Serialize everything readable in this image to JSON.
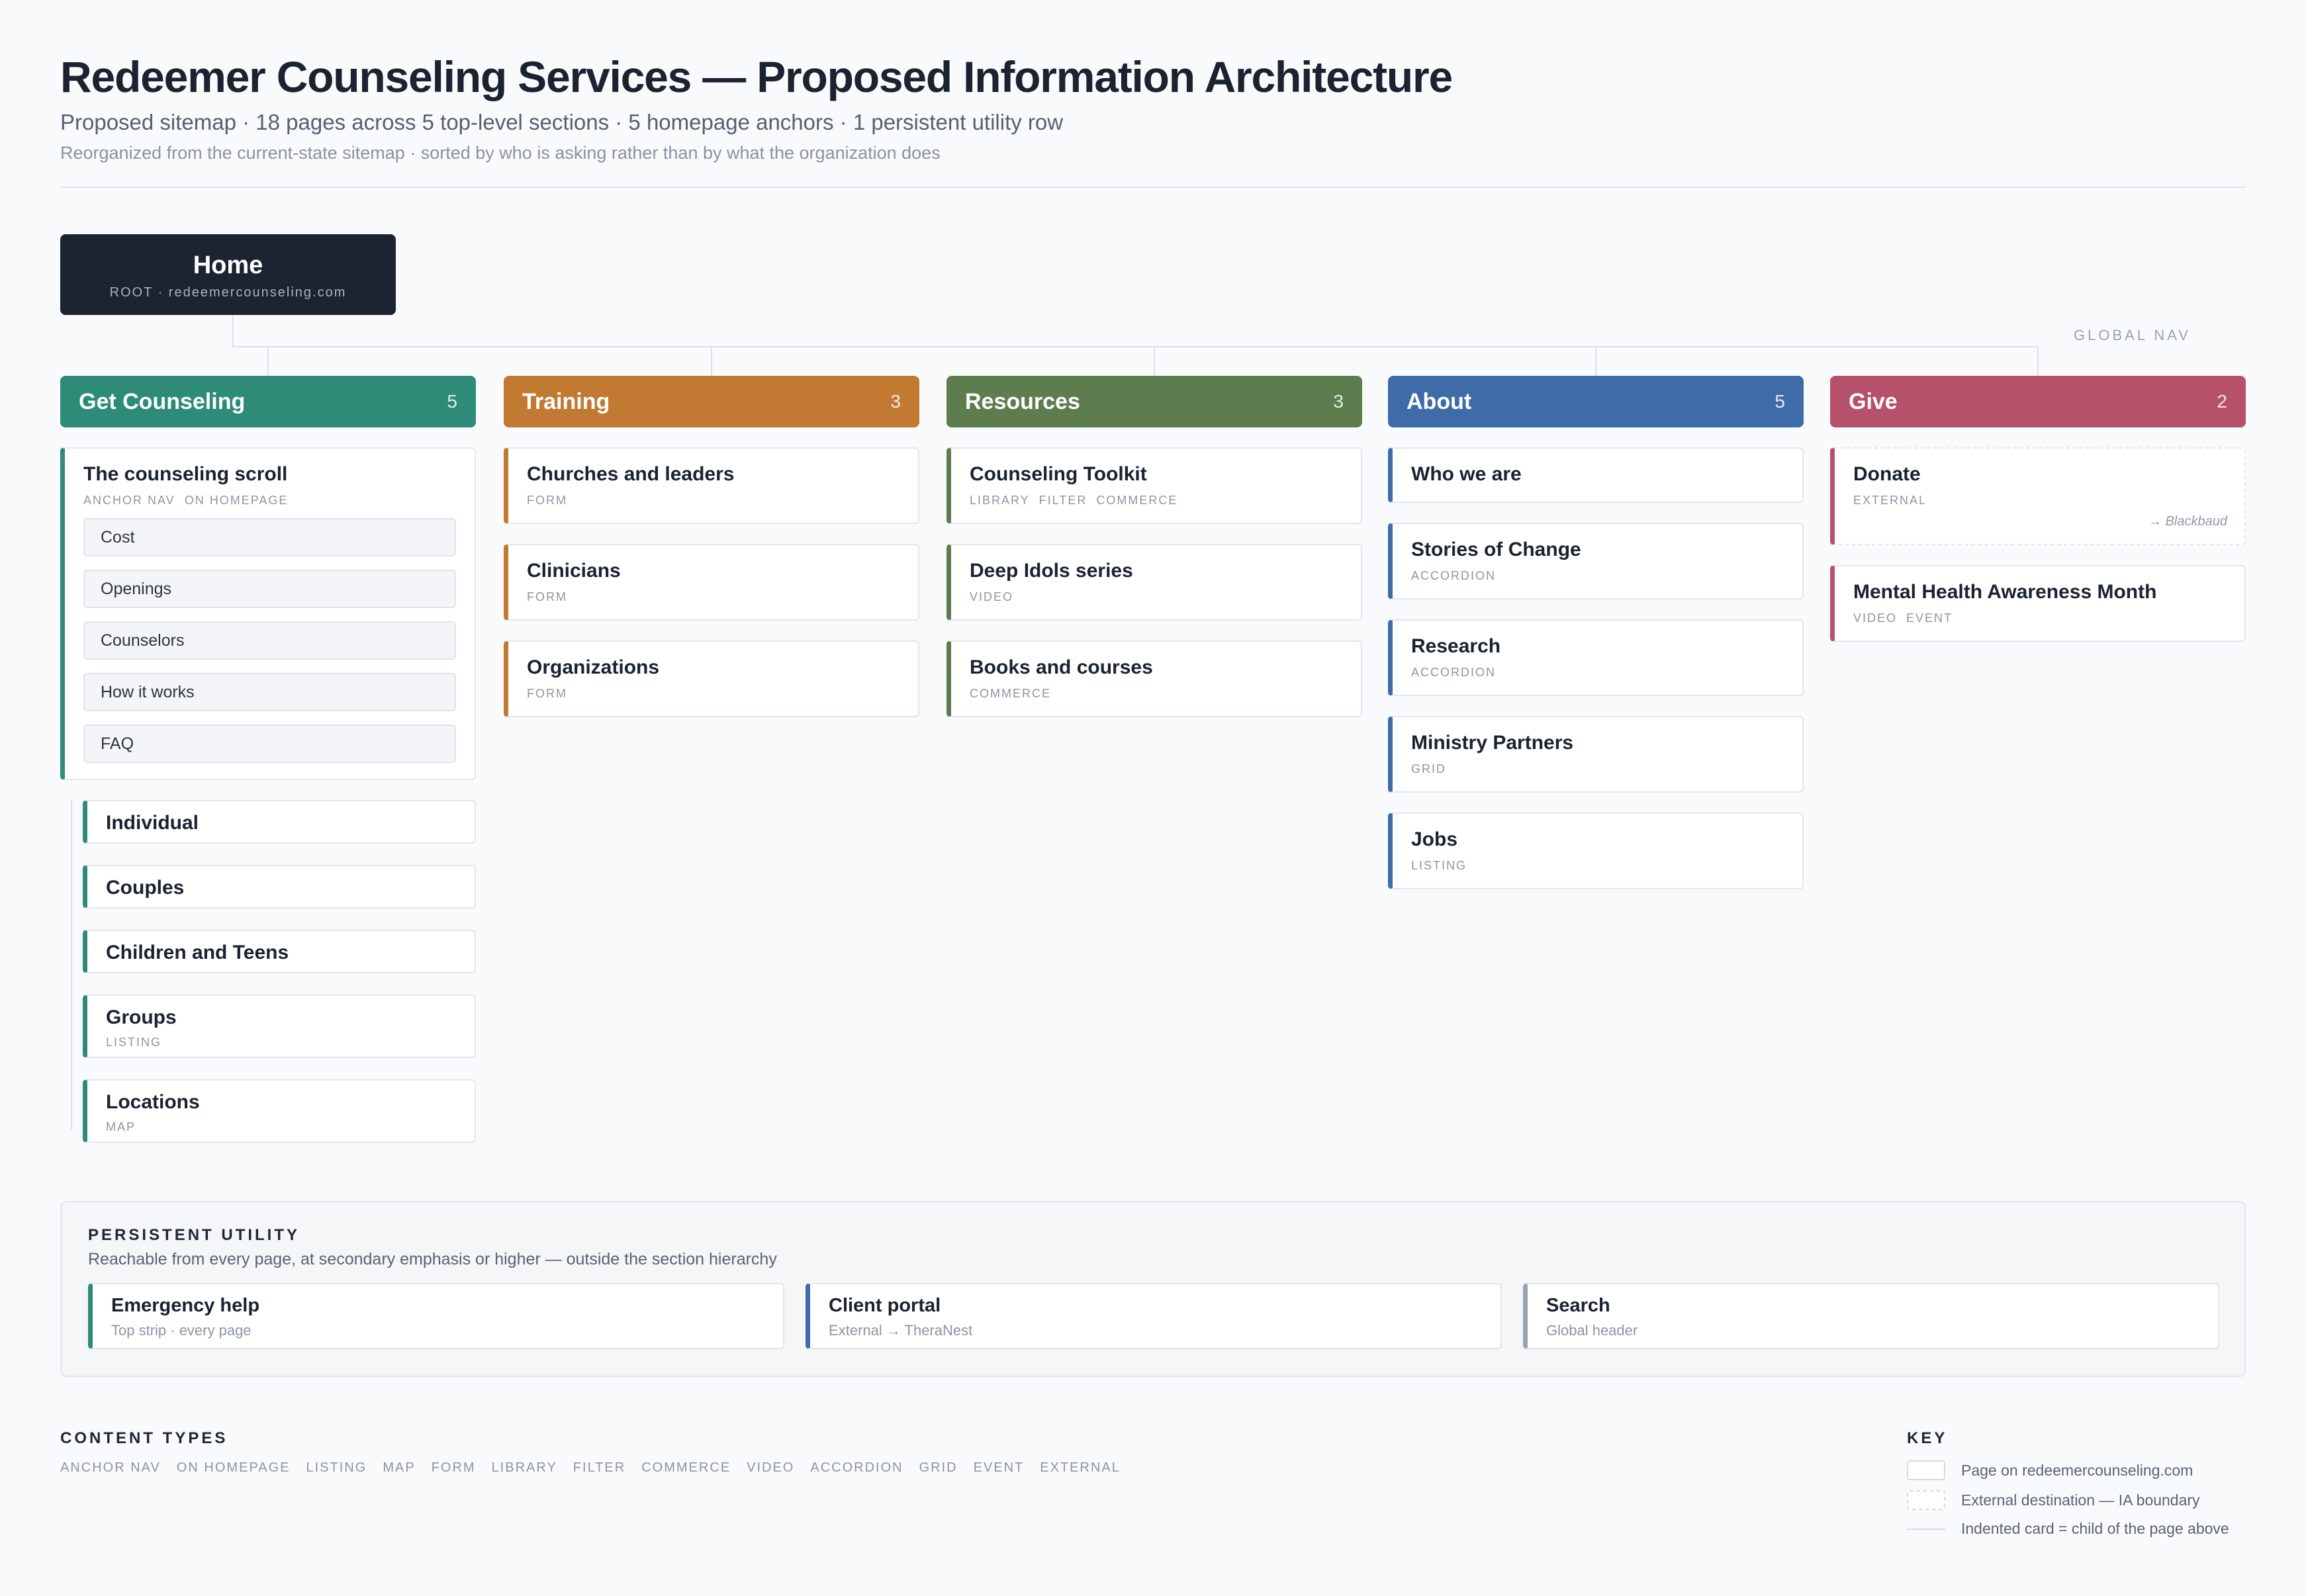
{
  "header": {
    "title": "Redeemer Counseling Services — Proposed Information Architecture",
    "subtitle": "Proposed sitemap · 18 pages across 5 top-level sections · 5 homepage anchors · 1 persistent utility row",
    "note": "Reorganized from the current-state sitemap · sorted by who is asking rather than by what the organization does"
  },
  "home": {
    "label": "Home",
    "sub": "ROOT · redeemercounseling.com"
  },
  "global_nav_label": "GLOBAL NAV",
  "sections": [
    {
      "name": "Get Counseling",
      "count": "5",
      "color": "#2e8b77",
      "scroll": {
        "name": "The counseling scroll",
        "tags": [
          "ANCHOR NAV",
          "ON HOMEPAGE"
        ],
        "anchors": [
          "Cost",
          "Openings",
          "Counselors",
          "How it works",
          "FAQ"
        ]
      },
      "children": [
        {
          "name": "Individual",
          "tags": []
        },
        {
          "name": "Couples",
          "tags": []
        },
        {
          "name": "Children and Teens",
          "tags": []
        },
        {
          "name": "Groups",
          "tags": [
            "LISTING"
          ]
        },
        {
          "name": "Locations",
          "tags": [
            "MAP"
          ]
        }
      ]
    },
    {
      "name": "Training",
      "count": "3",
      "color": "#c27a32",
      "pages": [
        {
          "name": "Churches and leaders",
          "tags": [
            "FORM"
          ]
        },
        {
          "name": "Clinicians",
          "tags": [
            "FORM"
          ]
        },
        {
          "name": "Organizations",
          "tags": [
            "FORM"
          ]
        }
      ]
    },
    {
      "name": "Resources",
      "count": "3",
      "color": "#5e7d4e",
      "pages": [
        {
          "name": "Counseling Toolkit",
          "tags": [
            "LIBRARY",
            "FILTER",
            "COMMERCE"
          ]
        },
        {
          "name": "Deep Idols series",
          "tags": [
            "VIDEO"
          ]
        },
        {
          "name": "Books and courses",
          "tags": [
            "COMMERCE"
          ]
        }
      ]
    },
    {
      "name": "About",
      "count": "5",
      "color": "#3f6ca8",
      "pages": [
        {
          "name": "Who we are",
          "tags": []
        },
        {
          "name": "Stories of Change",
          "tags": [
            "ACCORDION"
          ]
        },
        {
          "name": "Research",
          "tags": [
            "ACCORDION"
          ]
        },
        {
          "name": "Ministry Partners",
          "tags": [
            "GRID"
          ]
        },
        {
          "name": "Jobs",
          "tags": [
            "LISTING"
          ]
        }
      ]
    },
    {
      "name": "Give",
      "count": "2",
      "color": "#b5516a",
      "pages": [
        {
          "name": "Donate",
          "tags": [
            "EXTERNAL"
          ],
          "external": true,
          "destination": "→ Blackbaud"
        },
        {
          "name": "Mental Health Awareness Month",
          "tags": [
            "VIDEO",
            "EVENT"
          ]
        }
      ]
    }
  ],
  "utility": {
    "title": "PERSISTENT UTILITY",
    "description": "Reachable from every page, at secondary emphasis or higher — outside the section hierarchy",
    "items": [
      {
        "name": "Emergency help",
        "note": "Top strip · every page",
        "color": "#2e8b77"
      },
      {
        "name": "Client portal",
        "note": "External → TheraNest",
        "color": "#3f6ca8"
      },
      {
        "name": "Search",
        "note": "Global header",
        "color": "#9aa3b1"
      }
    ]
  },
  "content_types": {
    "title": "CONTENT TYPES",
    "items": [
      "ANCHOR NAV",
      "ON HOMEPAGE",
      "LISTING",
      "MAP",
      "FORM",
      "LIBRARY",
      "FILTER",
      "COMMERCE",
      "VIDEO",
      "ACCORDION",
      "GRID",
      "EVENT",
      "EXTERNAL"
    ]
  },
  "key": {
    "title": "KEY",
    "items": [
      {
        "swatch": "solid",
        "label": "Page on redeemercounseling.com"
      },
      {
        "swatch": "dashed",
        "label": "External destination — IA boundary"
      },
      {
        "swatch": "line",
        "label": "Indented card = child of the page above"
      }
    ]
  }
}
